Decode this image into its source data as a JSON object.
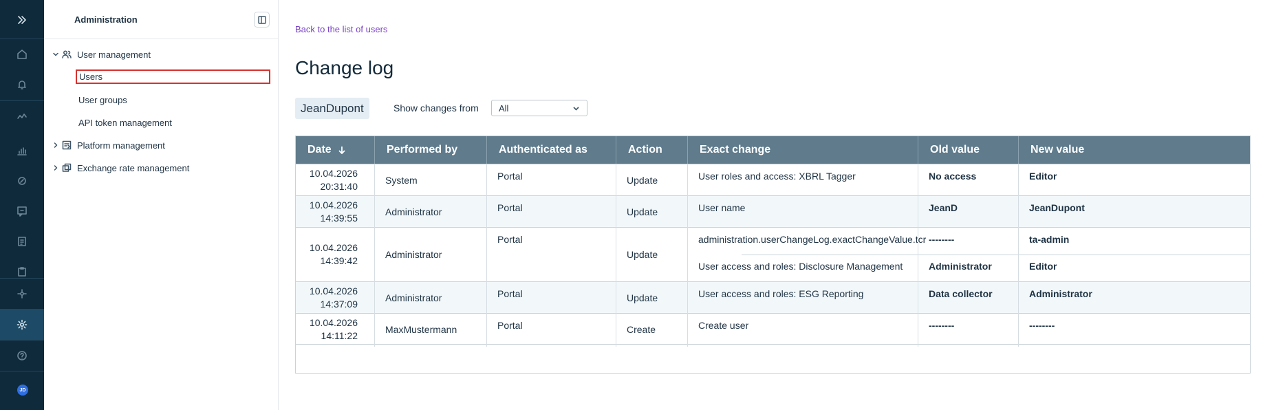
{
  "sidebar": {
    "title": "Administration",
    "items": [
      {
        "label": "User management",
        "icon": "users-icon"
      },
      {
        "label": "Users"
      },
      {
        "label": "User groups"
      },
      {
        "label": "API token management"
      },
      {
        "label": "Platform management",
        "icon": "platform-icon"
      },
      {
        "label": "Exchange rate management",
        "icon": "exchange-icon"
      }
    ]
  },
  "rail": {
    "avatar_initials": "JD"
  },
  "main": {
    "back_link": "Back to the list of users",
    "title": "Change log",
    "user_chip": "JeanDupont",
    "filter_label": "Show changes from",
    "filter_value": "All"
  },
  "table": {
    "headers": [
      "Date",
      "Performed by",
      "Authenticated as",
      "Action",
      "Exact change",
      "Old value",
      "New value"
    ],
    "rows": [
      {
        "date": "10.04.2026",
        "time": "20:31:40",
        "performed_by": "System",
        "auth": "Portal",
        "action": "Update",
        "changes": [
          {
            "exact": "User roles and access: XBRL Tagger",
            "old": "No access",
            "new": "Editor"
          }
        ]
      },
      {
        "date": "10.04.2026",
        "time": "14:39:55",
        "performed_by": "Administrator",
        "auth": "Portal",
        "action": "Update",
        "changes": [
          {
            "exact": "User name",
            "old": "JeanD",
            "new": "JeanDupont"
          }
        ]
      },
      {
        "date": "10.04.2026",
        "time": "14:39:42",
        "performed_by": "Administrator",
        "auth": "Portal",
        "action": "Update",
        "changes": [
          {
            "exact": "administration.userChangeLog.exactChangeValue.tcr",
            "old": "--------",
            "new": "ta-admin"
          },
          {
            "exact": "User access and roles: Disclosure Management",
            "old": "Administrator",
            "new": "Editor"
          }
        ]
      },
      {
        "date": "10.04.2026",
        "time": "14:37:09",
        "performed_by": "Administrator",
        "auth": "Portal",
        "action": "Update",
        "changes": [
          {
            "exact": "User access and roles: ESG Reporting",
            "old": "Data collector",
            "new": "Administrator"
          }
        ]
      },
      {
        "date": "10.04.2026",
        "time": "14:11:22",
        "performed_by": "MaxMustermann",
        "auth": "Portal",
        "action": "Create",
        "changes": [
          {
            "exact": "Create user",
            "old": "--------",
            "new": "--------"
          }
        ]
      }
    ]
  }
}
